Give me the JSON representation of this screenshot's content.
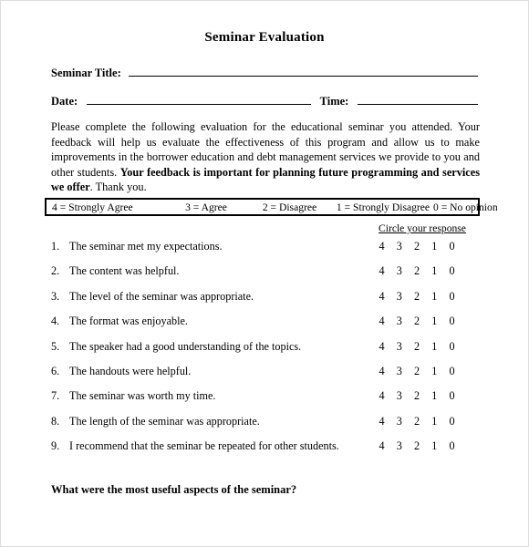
{
  "document": {
    "title": "Seminar Evaluation"
  },
  "fields": [
    {
      "label": "Seminar Title:",
      "value": ""
    },
    {
      "label": "Date:",
      "value": ""
    },
    {
      "label": "Time:",
      "value": ""
    }
  ],
  "intro": {
    "part1": "Please complete the following evaluation for the educational seminar you attended. Your feedback will help us evaluate the effectiveness of this program and allow us to make improvements in the borrower education and debt management services we provide to you and other students. ",
    "bold": "Your feedback is important for planning future programming and services we offer",
    "part2": ".  Thank you."
  },
  "scale": {
    "items": [
      "4 = Strongly Agree",
      "3 = Agree",
      "2 = Disagree",
      "1 = Strongly Disagree",
      "0 = No opinion"
    ]
  },
  "response_hint": "Circle your response",
  "response_options": [
    "4",
    "3",
    "2",
    "1",
    "0"
  ],
  "questions": [
    {
      "num": "1.",
      "text": "The seminar met my expectations."
    },
    {
      "num": "2.",
      "text": "The content was helpful."
    },
    {
      "num": "3.",
      "text": "The level of the seminar was appropriate."
    },
    {
      "num": "4.",
      "text": "The format was enjoyable."
    },
    {
      "num": "5.",
      "text": "The speaker had a good understanding of the topics."
    },
    {
      "num": "6.",
      "text": "The handouts were helpful."
    },
    {
      "num": "7.",
      "text": "The seminar was worth my time."
    },
    {
      "num": "8.",
      "text": "The length of the seminar was appropriate."
    },
    {
      "num": "9.",
      "text": "I recommend that the seminar be repeated for other students."
    }
  ],
  "closing_question": "What were the most useful aspects of the seminar?",
  "colors": {
    "text": "#000000",
    "page_background": "#ffffff",
    "page_border": "#dddddd",
    "rule": "#000000"
  }
}
